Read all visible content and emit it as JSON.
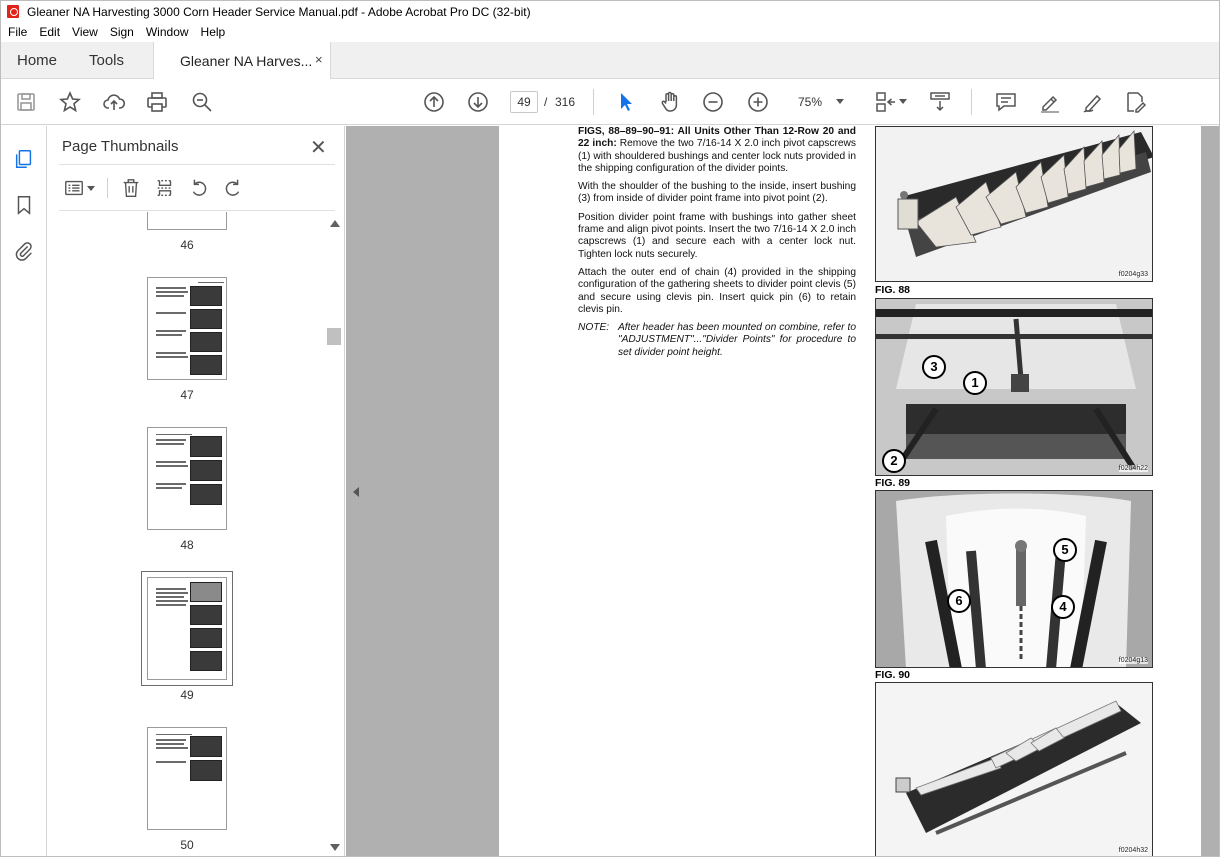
{
  "window": {
    "title": "Gleaner NA Harvesting 3000 Corn Header Service Manual.pdf - Adobe Acrobat Pro DC (32-bit)"
  },
  "menu": [
    "File",
    "Edit",
    "View",
    "Sign",
    "Window",
    "Help"
  ],
  "tabs": {
    "home": "Home",
    "tools": "Tools",
    "document": "Gleaner NA Harves...",
    "close_symbol": "×"
  },
  "toolbar": {
    "current_page": "49",
    "slash": "/",
    "total_pages": "316",
    "zoom": "75%"
  },
  "thumbnails_panel": {
    "title": "Page Thumbnails",
    "close_symbol": "✕",
    "pages": [
      {
        "number": "46"
      },
      {
        "number": "47"
      },
      {
        "number": "48"
      },
      {
        "number": "49",
        "selected": true
      },
      {
        "number": "50"
      }
    ]
  },
  "document": {
    "heading_bold": "FIGS, 88–89–90–91: All Units Other Than 12-Row 20 and 22 inch:",
    "heading_rest": " Remove the two 7/16-14 X 2.0 inch pivot capscrews (1) with shouldered bushings and center lock nuts provided in the shipping configuration of the divider points.",
    "p2": "With the shoulder of the bushing to the inside, insert bushing (3) from inside of divider point frame into pivot point (2).",
    "p3": "Position divider point frame with bushings into gather sheet frame and align pivot points. Insert the two 7/16-14 X 2.0 inch capscrews (1) and secure each with a center lock nut. Tighten lock nuts securely.",
    "p4": "Attach the outer end of chain (4) provided in the shipping configuration of the gathering sheets to divider point clevis (5) and secure using clevis pin. Insert quick pin (6) to retain clevis pin.",
    "note_label": "NOTE:",
    "note_text": "After header has been mounted on combine, refer to \"ADJUSTMENT\"...\"Divider Points\" for procedure to set divider point height.",
    "figures": [
      {
        "label": "FIG. 88",
        "code": "f0204g33"
      },
      {
        "label": "FIG. 89",
        "code": "f0204h22",
        "callouts": [
          "3",
          "1",
          "2"
        ]
      },
      {
        "label": "FIG. 90",
        "code": "f0204g13",
        "callouts": [
          "5",
          "6",
          "4"
        ]
      },
      {
        "label": "",
        "code": "f0204h32"
      }
    ]
  },
  "colors": {
    "accent_blue": "#1473e6",
    "pdf_red": "#e0241a",
    "doc_background": "#b0b0b0"
  }
}
